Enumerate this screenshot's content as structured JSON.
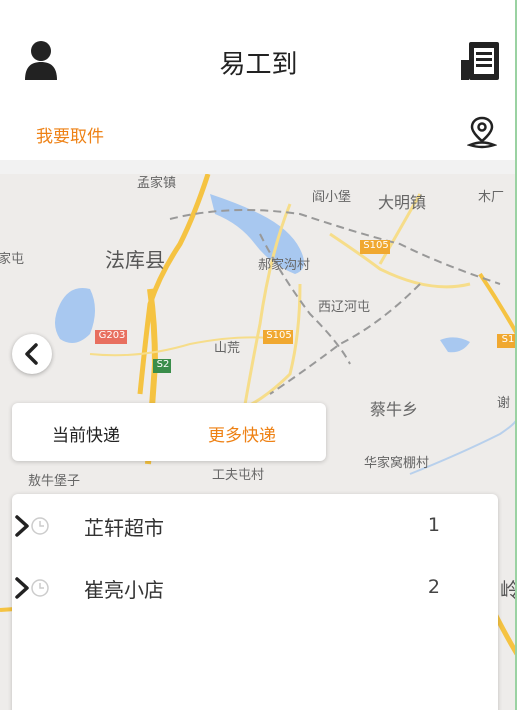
{
  "header": {
    "title": "易工到",
    "left_icon": "user-icon",
    "right_icon": "document-icon"
  },
  "subbar": {
    "pickup_label": "我要取件",
    "pickup_color": "#ee8114",
    "right_icon": "location-pin-icon"
  },
  "map": {
    "labels": [
      "孟家镇",
      "阎小堡",
      "大明镇",
      "木厂",
      "家屯",
      "法库县",
      "郝家沟村",
      "S105",
      "西辽河屯",
      "G203",
      "山荒",
      "S105",
      "S2",
      "S1",
      "蔡牛乡",
      "谢",
      "敖牛堡子",
      "工夫屯村",
      "华家窝棚村",
      "岭"
    ]
  },
  "tabs": {
    "current": "当前快递",
    "more": "更多快递"
  },
  "list": {
    "items": [
      {
        "name": "芷轩超市",
        "count": "1"
      },
      {
        "name": "崔亮小店",
        "count": "2"
      }
    ]
  }
}
